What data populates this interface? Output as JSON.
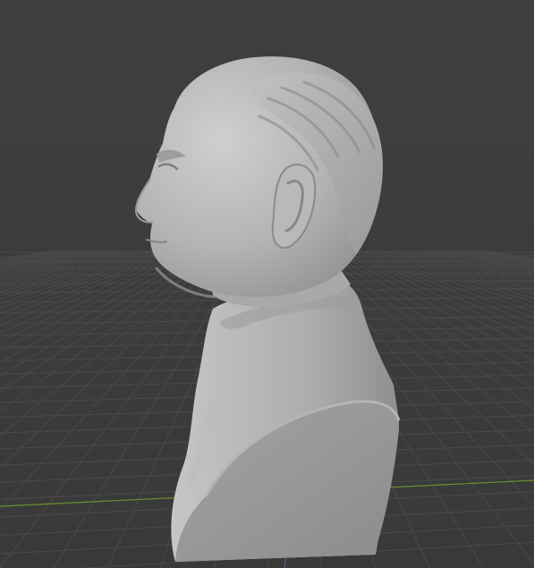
{
  "viewport": {
    "background_color": "#3d3d3d",
    "grid_color": "#4a4a4a",
    "x_axis_color": "#6a8f2e",
    "y_axis_color": "#4e6b8a",
    "model": {
      "subject": "bust-sculpture",
      "material_color": "#a6a6a6",
      "shading": "solid"
    }
  }
}
